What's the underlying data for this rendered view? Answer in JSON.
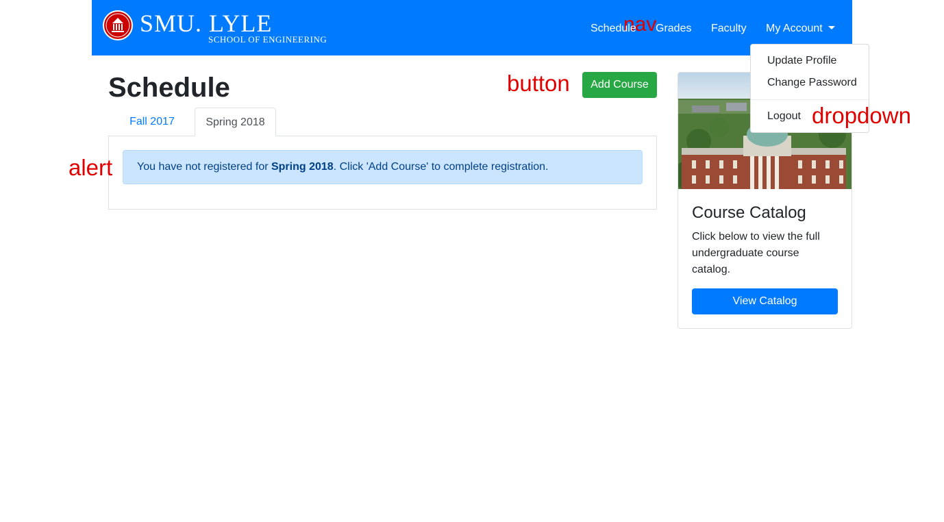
{
  "nav": {
    "brand_main": "SMU. LYLE",
    "brand_sub": "SCHOOL OF ENGINEERING",
    "annotation": "nav",
    "links": [
      "Schedule",
      "Grades",
      "Faculty",
      "My Account"
    ]
  },
  "header": {
    "title": "Schedule",
    "button_annotation": "button",
    "add_course_label": "Add Course"
  },
  "tabs": [
    {
      "label": "Fall 2017",
      "active": false
    },
    {
      "label": "Spring 2018",
      "active": true
    }
  ],
  "alert": {
    "annotation": "alert",
    "text_before": "You have not registered for ",
    "term": "Spring 2018",
    "text_after": ". Click 'Add Course' to complete registration."
  },
  "card": {
    "title": "Course Catalog",
    "text": "Click below to view the full undergraduate course catalog.",
    "button_label": "View Catalog"
  },
  "dropdown": {
    "annotation": "dropdown",
    "items": [
      "Update Profile",
      "Change Password",
      "Logout"
    ]
  },
  "colors": {
    "primary": "#007bff",
    "success": "#28a745",
    "alert_bg": "#cce5ff",
    "annotation_red": "#e00000",
    "brand_red": "#cc0000"
  }
}
